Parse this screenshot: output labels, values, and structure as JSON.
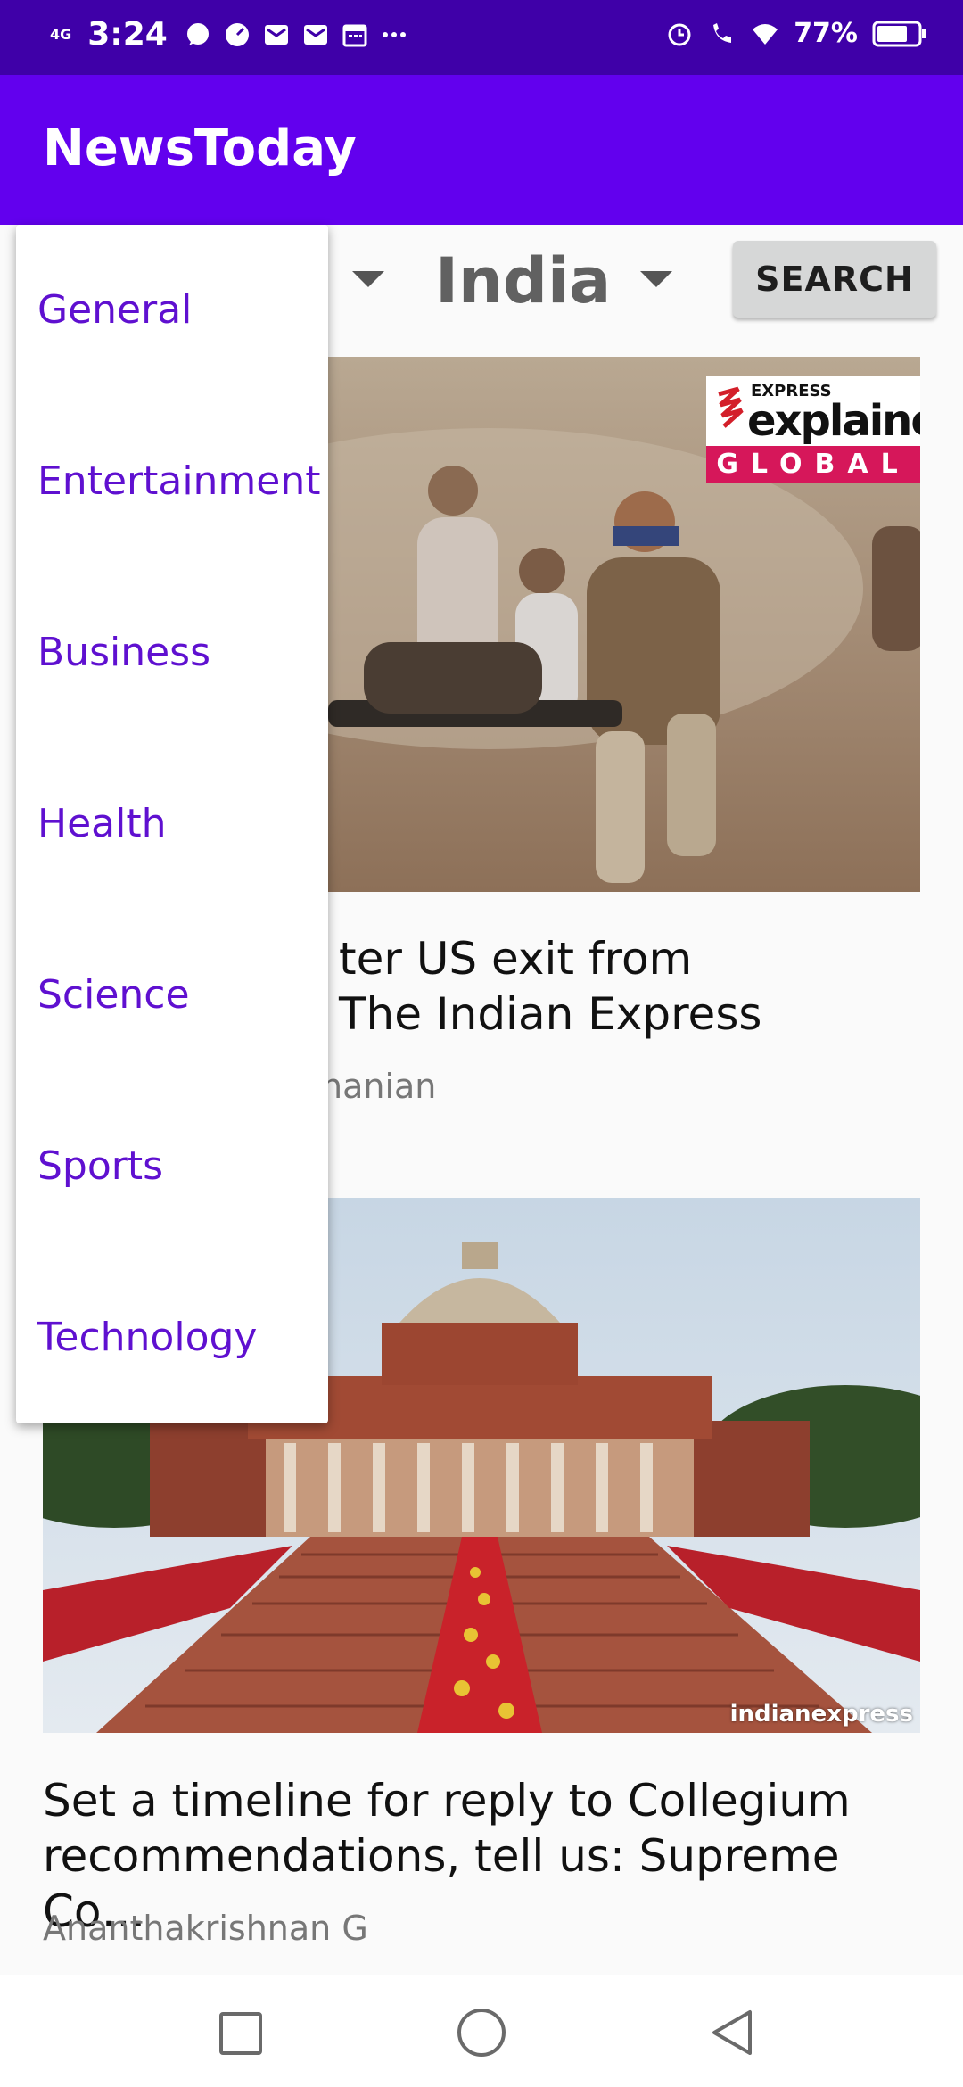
{
  "status_bar": {
    "network": "4G",
    "time": "3:24",
    "battery": "77%"
  },
  "app_bar": {
    "title": "NewsToday"
  },
  "controls": {
    "country_selected": "India",
    "search_label": "SEARCH"
  },
  "dropdown": {
    "items": [
      "General",
      "Entertainment",
      "Business",
      "Health",
      "Science",
      "Sports",
      "Technology"
    ]
  },
  "articles": [
    {
      "title_line1": "ter US exit from",
      "title_line2": "The Indian Express",
      "author_partial": "nanian",
      "badge_top": "EXPRESS",
      "badge_main": "explainec",
      "badge_bottom": "GLOBAL"
    },
    {
      "title_line1": "Set a timeline for reply to Collegium",
      "title_line2": "recommendations, tell us: Supreme Co…",
      "author": "Ananthakrishnan G",
      "watermark": "indianexpress"
    }
  ],
  "icons": {
    "status_left": [
      "message-icon",
      "speedometer-icon",
      "mail-icon",
      "mail-icon",
      "calendar-icon",
      "more-icon"
    ],
    "status_right": [
      "alarm-icon",
      "wifi-call-icon",
      "wifi-icon",
      "battery-icon"
    ],
    "nav": [
      "recents-square-icon",
      "home-circle-icon",
      "back-triangle-icon"
    ]
  }
}
